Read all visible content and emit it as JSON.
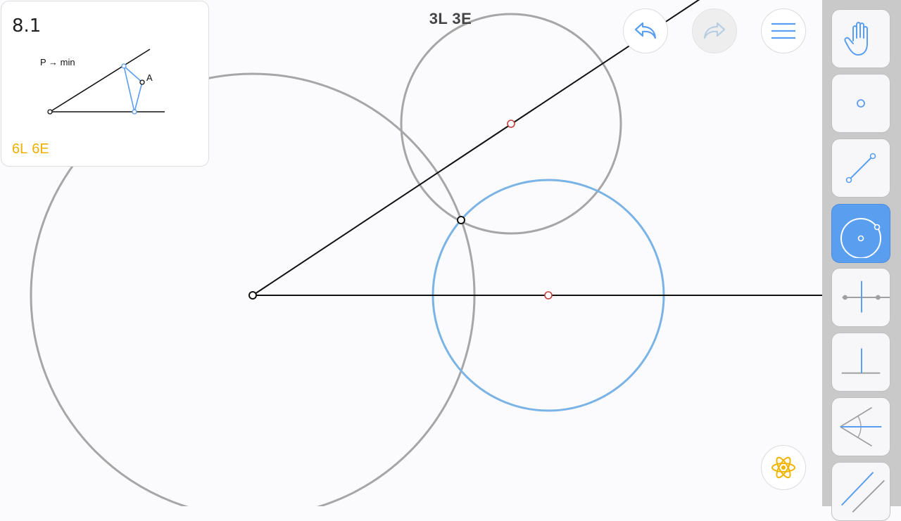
{
  "level": {
    "number": "8.1",
    "preview_text": "P → min",
    "preview_point_label": "A",
    "score_lines": "6L",
    "score_elements": "6E"
  },
  "moves": {
    "lines": "3L",
    "elements": "3E"
  },
  "buttons": {
    "undo": "undo-icon",
    "redo": "redo-icon",
    "menu": "menu-icon",
    "hint": "hint-icon"
  },
  "toolbar": {
    "tools": [
      {
        "name": "move",
        "icon": "hand-icon",
        "active": false
      },
      {
        "name": "point",
        "icon": "point-icon",
        "active": false
      },
      {
        "name": "line",
        "icon": "line-icon",
        "active": false
      },
      {
        "name": "circle",
        "icon": "circle-icon",
        "active": true
      },
      {
        "name": "perpendicular-bisector",
        "icon": "perpendicular-bisector-icon",
        "active": false
      },
      {
        "name": "perpendicular",
        "icon": "perpendicular-icon",
        "active": false
      },
      {
        "name": "angle-bisector",
        "icon": "angle-bisector-icon",
        "active": false
      },
      {
        "name": "parallel",
        "icon": "parallel-icon",
        "active": false
      }
    ]
  },
  "colors": {
    "accent": "#5a9ef0",
    "construction_circle": "#a6a6a6",
    "active_circle": "#7ab4e6",
    "score": "#f0b000",
    "marker": "#c04040"
  }
}
